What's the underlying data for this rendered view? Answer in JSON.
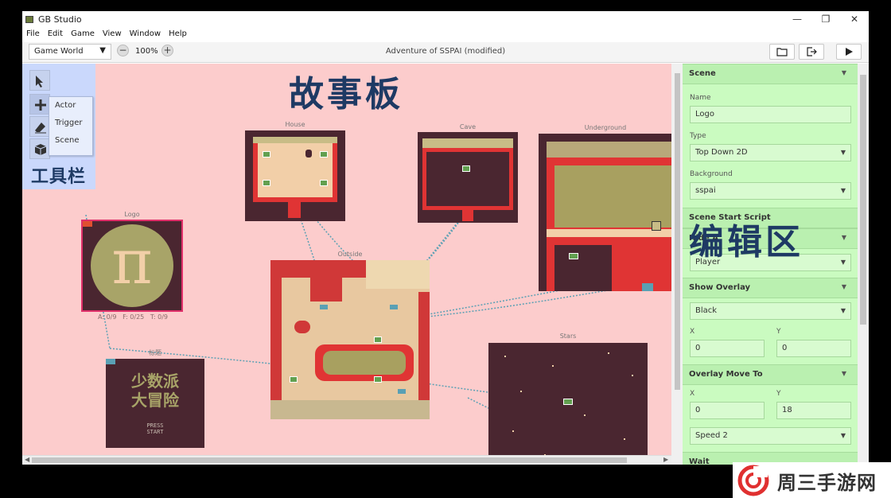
{
  "window": {
    "title": "GB Studio",
    "minimize": "—",
    "maximize": "❐",
    "close": "✕"
  },
  "menu": [
    "File",
    "Edit",
    "Game",
    "View",
    "Window",
    "Help"
  ],
  "toolbar": {
    "view_select": "Game World",
    "zoom_out": "−",
    "zoom_in": "+",
    "zoom": "100%",
    "document_title": "Adventure of SSPAI (modified)"
  },
  "tools": {
    "add_menu": [
      "Actor",
      "Trigger",
      "Scene"
    ],
    "annotation": "工具栏"
  },
  "canvas": {
    "annotation": "故事板",
    "scenes": {
      "house": "House",
      "cave": "Cave",
      "underground": "Underground",
      "logo": "Logo",
      "outside": "Outside",
      "stars": "Stars",
      "title": "标题"
    },
    "logo_stats": "A: 0/9   F: 0/25   T: 0/9",
    "logo_symbol": "π",
    "title_screen": {
      "line1": "少数派",
      "line2": "大冒险",
      "press1": "PRESS",
      "press2": "START"
    }
  },
  "editor": {
    "annotation": "编辑区",
    "scene_header": "Scene",
    "name_label": "Name",
    "name_value": "Logo",
    "type_label": "Type",
    "type_value": "Top Down 2D",
    "background_label": "Background",
    "background_value": "sspai",
    "script_header": "Scene Start Script",
    "hide_header": "Hide A",
    "hide_value": "Player",
    "overlay_header": "Show Overlay",
    "overlay_value": "Black",
    "x_label": "X",
    "y_label": "Y",
    "overlay_x": "0",
    "overlay_y": "0",
    "move_header": "Overlay Move To",
    "move_x": "0",
    "move_y": "18",
    "speed_value": "Speed 2",
    "wait_header": "Wait"
  },
  "watermark": "周三手游网",
  "colors": {
    "canvas": "#fccccc",
    "tool_panel": "#cad8fc",
    "editor": "#cafbc0",
    "annotation": "#1e3a64",
    "link": "#5aa0b4"
  }
}
